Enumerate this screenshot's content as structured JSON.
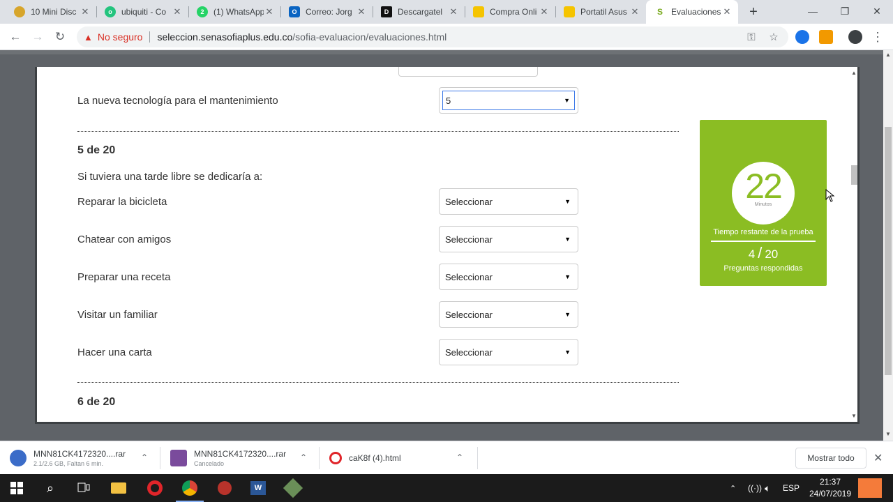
{
  "browser": {
    "tabs": [
      {
        "title": "10 Mini Disc",
        "icon": "yellow-disc-icon",
        "color": "#d7a52b"
      },
      {
        "title": "ubiquiti - Co",
        "icon": "olx-icon",
        "color": "#23c47e"
      },
      {
        "title": "(1) WhatsApp",
        "icon": "whatsapp-icon",
        "color": "#25d366"
      },
      {
        "title": "Correo: Jorg",
        "icon": "outlook-icon",
        "color": "#0a64c2"
      },
      {
        "title": "Descargatel",
        "icon": "dc-icon",
        "color": "#111111"
      },
      {
        "title": "Compra Onli",
        "icon": "store-icon",
        "color": "#f5c400"
      },
      {
        "title": "Portatil Asus",
        "icon": "store-icon",
        "color": "#f5c400"
      },
      {
        "title": "Evaluaciones",
        "icon": "sofia-icon",
        "color": "#7aab1f",
        "active": true
      }
    ],
    "security_label": "No seguro",
    "url_host": "seleccion.senasofiaplus.edu.co",
    "url_path": "/sofia-evaluacion/evaluaciones.html"
  },
  "survey": {
    "prev_item": {
      "label": "La nueva tecnología para el mantenimiento",
      "value": "5"
    },
    "question5": {
      "number": "5 de 20",
      "prompt": "Si tuviera una tarde libre se dedicaría a:",
      "options": [
        {
          "label": "Reparar la bicicleta",
          "value": "Seleccionar"
        },
        {
          "label": "Chatear con amigos",
          "value": "Seleccionar"
        },
        {
          "label": "Preparar una receta",
          "value": "Seleccionar"
        },
        {
          "label": "Visitar un familiar",
          "value": "Seleccionar"
        },
        {
          "label": "Hacer una carta",
          "value": "Seleccionar"
        }
      ]
    },
    "question6": {
      "number": "6 de 20"
    }
  },
  "timer": {
    "minutes": "22",
    "minutes_label": "Minutos",
    "remaining_label": "Tiempo restante de la prueba",
    "answered": "4",
    "total": "20",
    "answered_label": "Preguntas respondidas",
    "color": "#8bbd23"
  },
  "downloads": {
    "items": [
      {
        "name": "MNN81CK4172320....rar",
        "status": "2.1/2.6 GB, Faltan 6 min."
      },
      {
        "name": "MNN81CK4172320....rar",
        "status": "Cancelado"
      },
      {
        "name": "caK8f (4).html",
        "status": ""
      }
    ],
    "show_all": "Mostrar todo"
  },
  "taskbar": {
    "language": "ESP",
    "time": "21:37",
    "date": "24/07/2019"
  }
}
